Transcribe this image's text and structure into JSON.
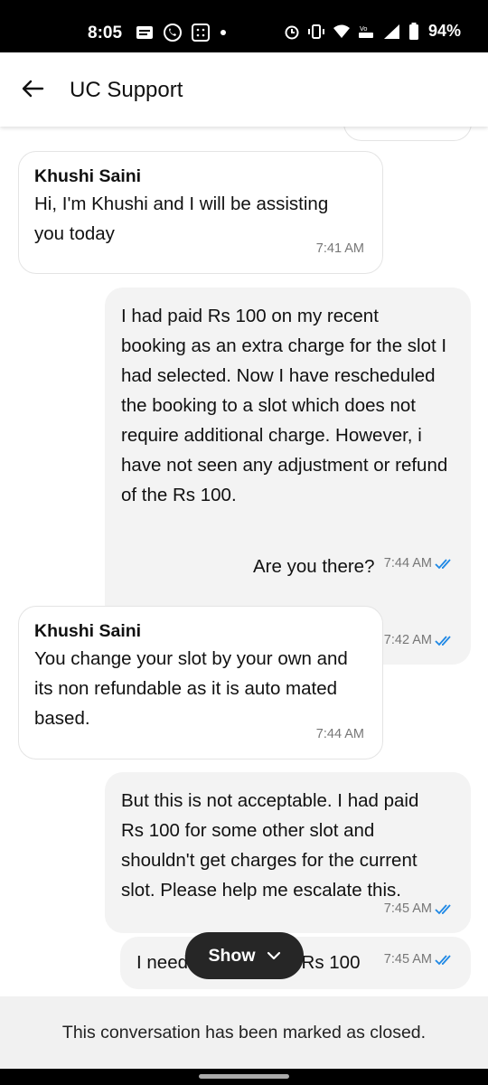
{
  "status_bar": {
    "time": "8:05",
    "battery": "94%"
  },
  "header": {
    "title": "UC Support"
  },
  "messages": [
    {
      "sender": "Khushi Saini",
      "text": "Hi, I'm Khushi and I will be assisting you today",
      "time": "7:41 AM"
    },
    {
      "text": "I had paid Rs 100 on my recent booking as an extra charge for the slot I had selected. Now I have rescheduled the booking to a slot which does not require additional charge. However, i have not seen any adjustment or refund of the Rs 100.",
      "time": "7:42 AM"
    },
    {
      "text": "Are you there?",
      "time": "7:44 AM"
    },
    {
      "sender": "Khushi Saini",
      "text": "You change your slot by your own and its non refundable as it is auto mated based.",
      "time": "7:44 AM"
    },
    {
      "text": "But this is not acceptable. I had paid Rs 100 for some other slot and shouldn't get charges for the current slot. Please help me escalate this.",
      "time": "7:45 AM"
    },
    {
      "text_left": "I need",
      "text_right": "r Rs 100",
      "time": "7:45 AM"
    }
  ],
  "show_button": {
    "label": "Show"
  },
  "footer": {
    "closed_notice": "This conversation has been marked as closed."
  },
  "colors": {
    "tick_blue": "#1e88e5",
    "outgoing_bg": "#f3f3f3"
  }
}
